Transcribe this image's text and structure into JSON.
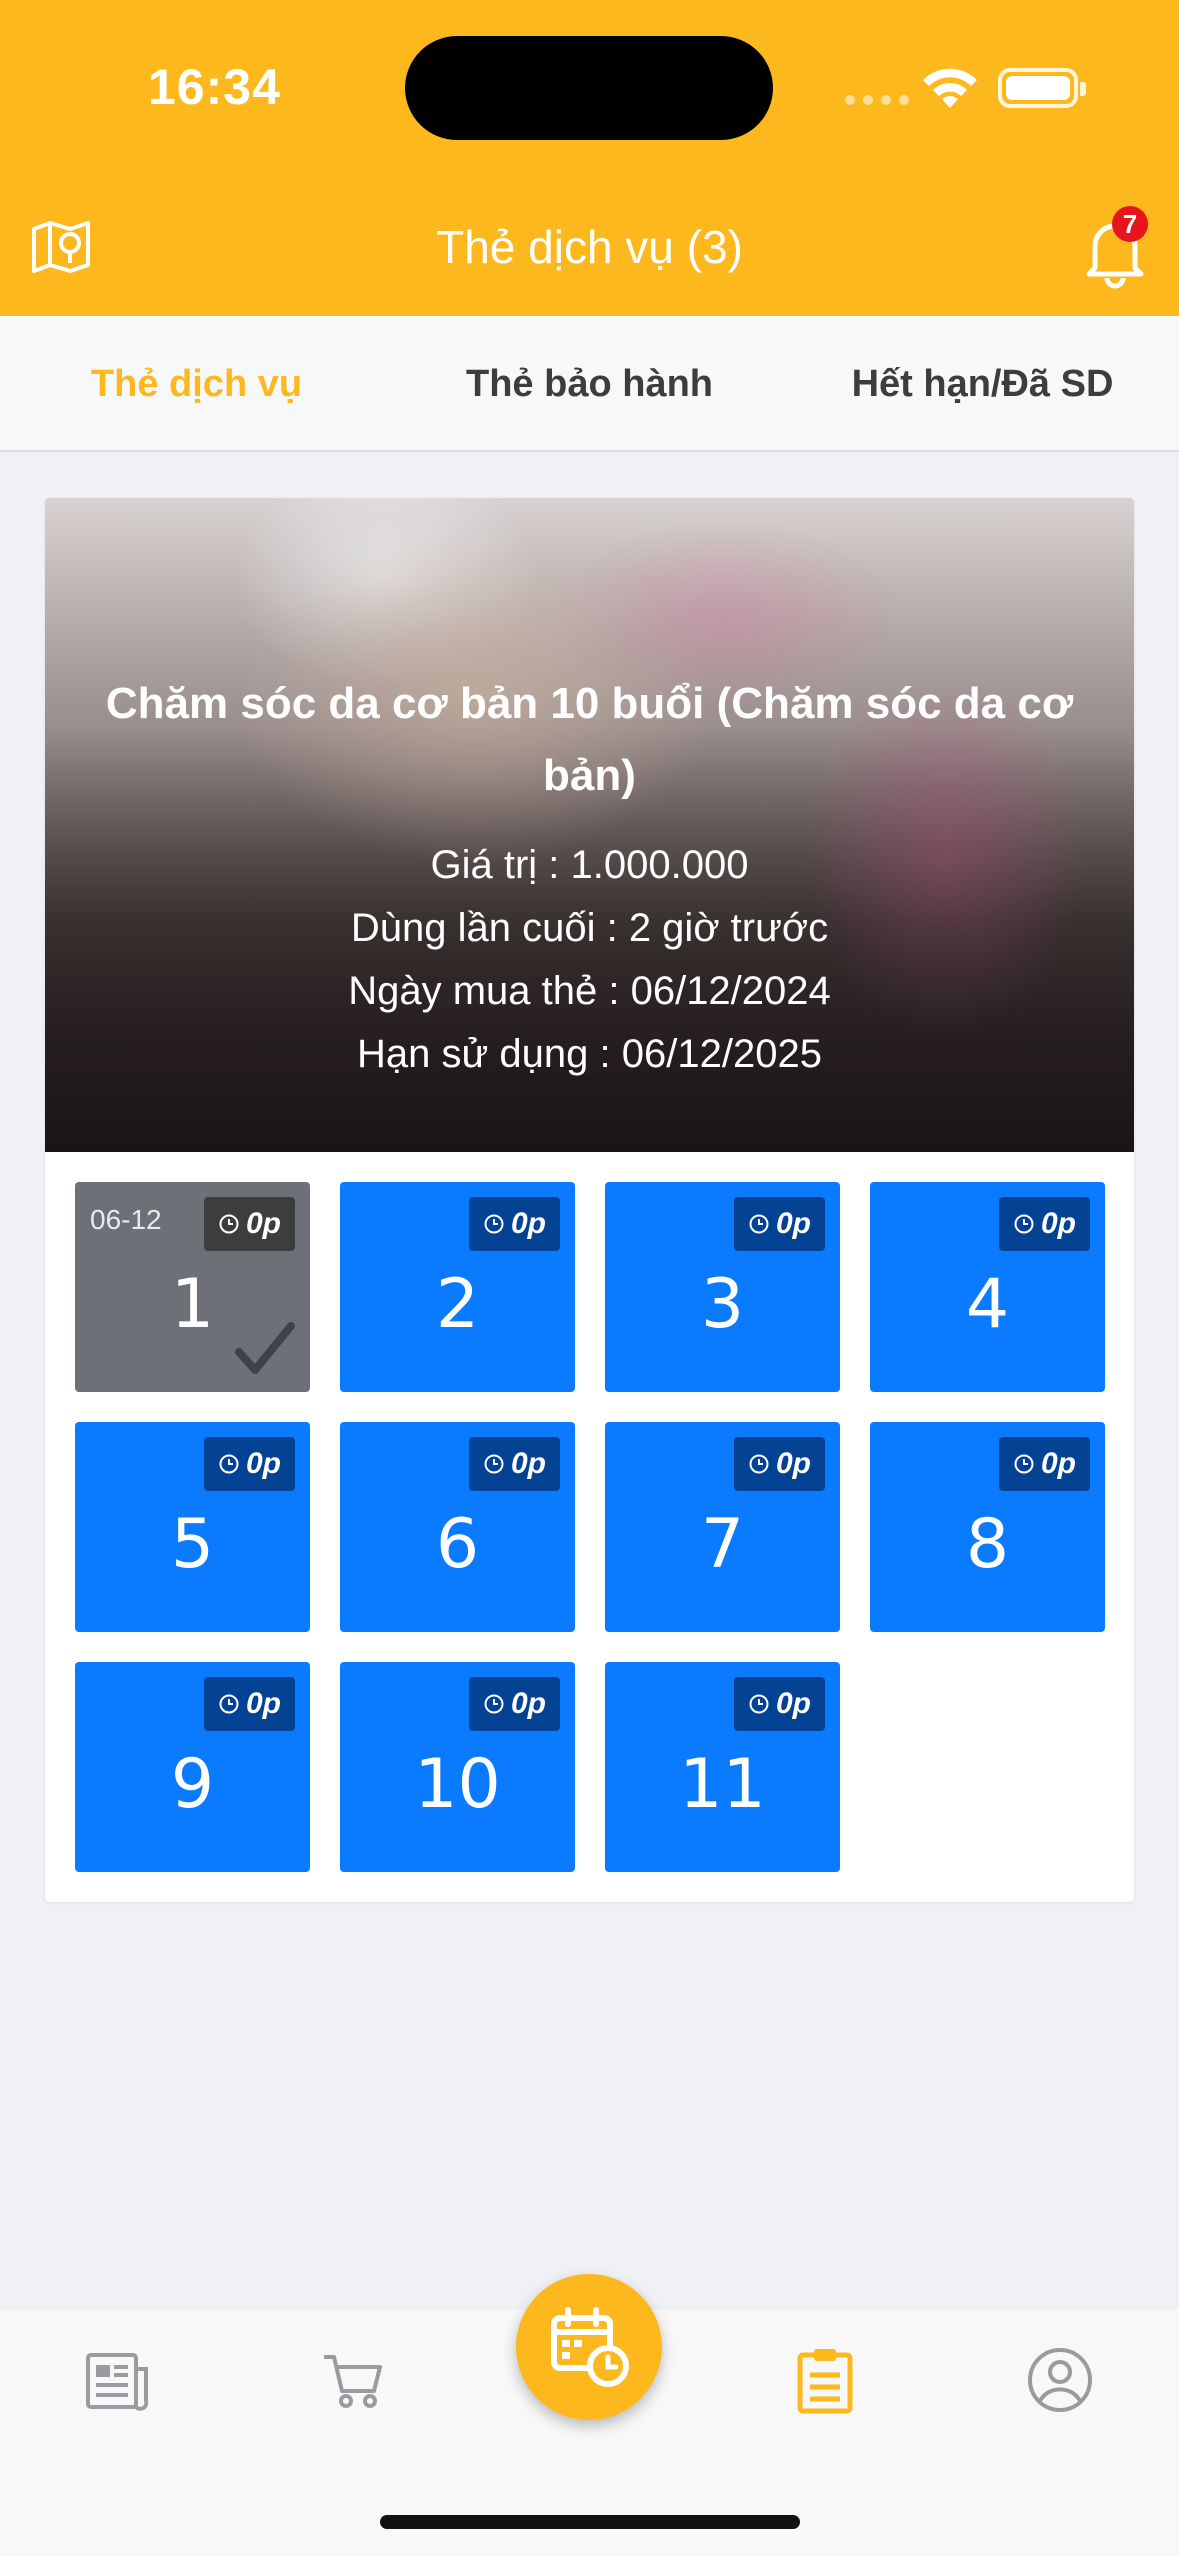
{
  "status_bar": {
    "time": "16:34"
  },
  "header": {
    "title": "Thẻ dịch vụ (3)",
    "notification_count": "7"
  },
  "tabs": [
    {
      "label": "Thẻ dịch vụ",
      "active": true
    },
    {
      "label": "Thẻ bảo hành",
      "active": false
    },
    {
      "label": "Hết hạn/Đã SD",
      "active": false
    }
  ],
  "card": {
    "title": "Chăm sóc da cơ bản 10 buổi (Chăm sóc da cơ bản)",
    "value_line": "Giá trị : 1.000.000",
    "last_used_line": "Dùng lần cuối : 2 giờ trước",
    "purchase_date_line": "Ngày mua thẻ : 06/12/2024",
    "expiry_line": "Hạn sử dụng : 06/12/2025",
    "sessions": [
      {
        "number": "1",
        "duration": "0p",
        "used": true,
        "date": "06-12"
      },
      {
        "number": "2",
        "duration": "0p",
        "used": false
      },
      {
        "number": "3",
        "duration": "0p",
        "used": false
      },
      {
        "number": "4",
        "duration": "0p",
        "used": false
      },
      {
        "number": "5",
        "duration": "0p",
        "used": false
      },
      {
        "number": "6",
        "duration": "0p",
        "used": false
      },
      {
        "number": "7",
        "duration": "0p",
        "used": false
      },
      {
        "number": "8",
        "duration": "0p",
        "used": false
      },
      {
        "number": "9",
        "duration": "0p",
        "used": false
      },
      {
        "number": "10",
        "duration": "0p",
        "used": false
      },
      {
        "number": "11",
        "duration": "0p",
        "used": false
      }
    ]
  },
  "bottom_nav": [
    {
      "icon": "news-icon",
      "active": false
    },
    {
      "icon": "cart-icon",
      "active": false
    },
    {
      "icon": "calendar-clock-icon",
      "active": false
    },
    {
      "icon": "clipboard-icon",
      "active": true
    },
    {
      "icon": "profile-icon",
      "active": false
    }
  ],
  "colors": {
    "brand": "#fdb81e",
    "session_available": "#0a7aff",
    "session_used": "#6d7177",
    "badge": "#e8141c"
  }
}
